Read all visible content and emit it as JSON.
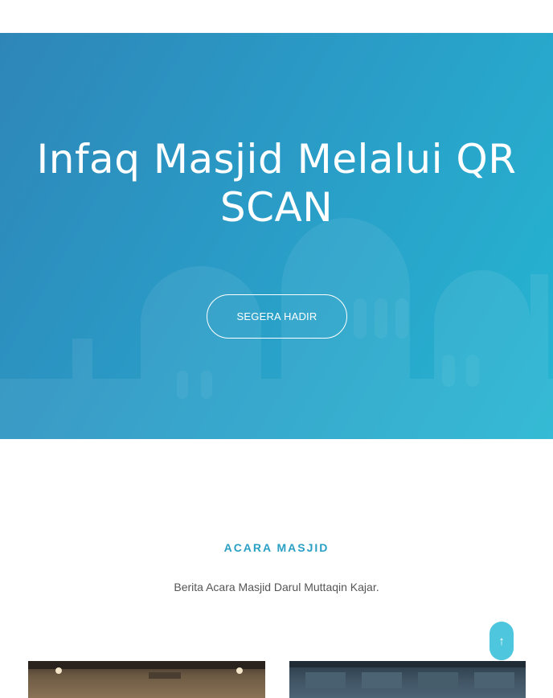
{
  "hero": {
    "title": "Infaq Masjid Melalui QR SCAN",
    "button_label": "SEGERA HADIR"
  },
  "events": {
    "title": "ACARA MASJID",
    "subtitle": "Berita Acara Masjid Darul Muttaqin Kajar."
  },
  "scroll_top": {
    "icon": "arrow-up-icon"
  },
  "colors": {
    "accent": "#2a9fc4",
    "hero_start": "#2e86b8",
    "hero_end": "#25b6d2",
    "scroll_button": "#4ec6de"
  }
}
